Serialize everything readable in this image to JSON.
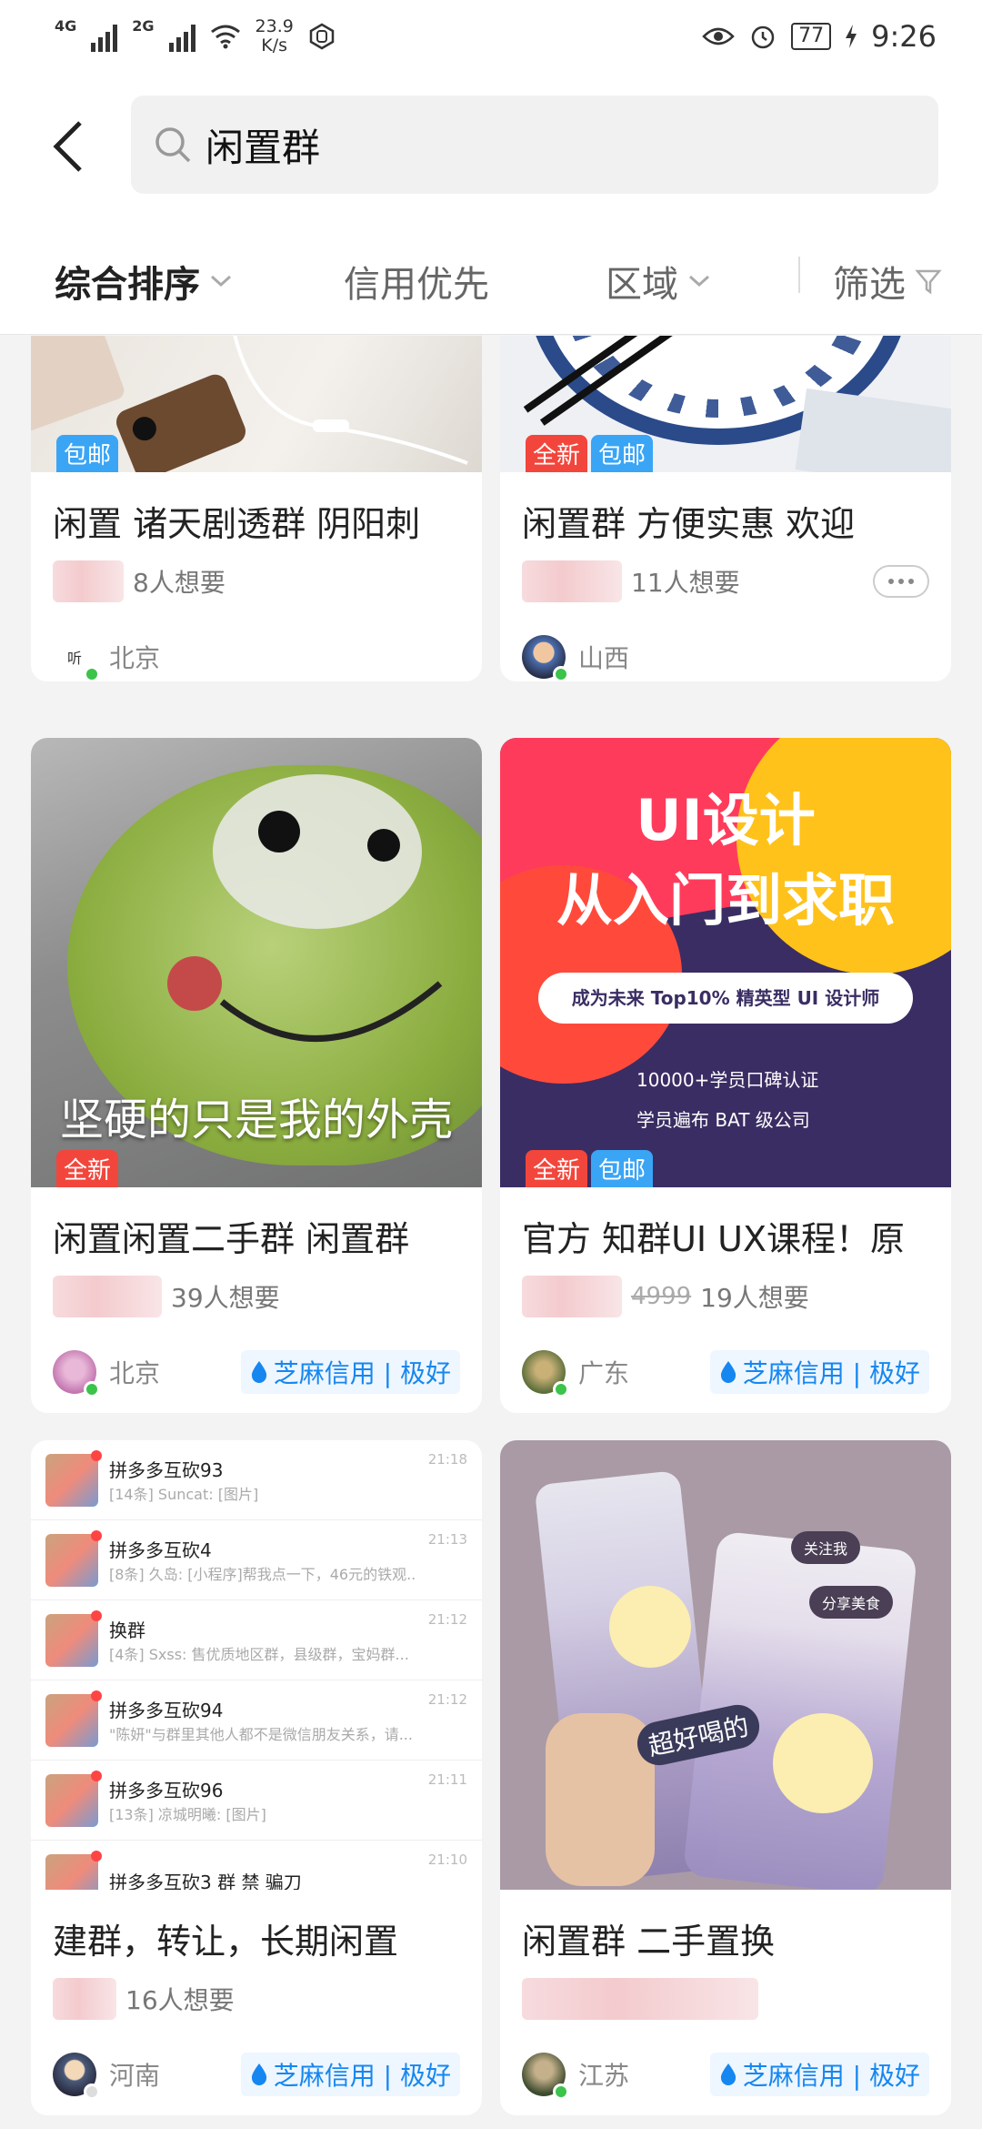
{
  "status": {
    "net1": "4G",
    "net2": "2G",
    "speed_value": "23.9",
    "speed_unit": "K/s",
    "battery": "77",
    "time": "9:26"
  },
  "search": {
    "query": "闲置群"
  },
  "filters": {
    "sort": "综合排序",
    "credit_first": "信用优先",
    "region": "区域",
    "filter": "筛选"
  },
  "tags": {
    "new": "全新",
    "package": "包邮"
  },
  "credit_label": "芝麻信用 | 极好",
  "cards": [
    {
      "title": "闲置 诸天剧透群 阴阳刺",
      "want": "8人想要",
      "location": "北京",
      "avatar_text": "听"
    },
    {
      "title": "闲置群   方便实惠  欢迎",
      "want": "11人想要",
      "location": "山西"
    },
    {
      "title": "闲置闲置二手群 闲置群",
      "want": "39人想要",
      "location": "北京",
      "image_caption": "坚硬的只是我的外壳"
    },
    {
      "title": "官方 知群UI UX课程！原",
      "price_fragment": "4999",
      "want": "19人想要",
      "location": "广东",
      "promo": {
        "line1": "UI设计",
        "line2": "从入门到求职",
        "pill": "成为未来 Top10% 精英型 UI 设计师",
        "bullet1": "10000+学员口碑认证",
        "bullet2": "学员遍布 BAT 级公司"
      }
    },
    {
      "title": "建群，转让，长期闲置",
      "want": "16人想要",
      "location": "河南",
      "chats": [
        {
          "name": "拼多多互砍93",
          "msg": "[14条] Suncat: [图片]",
          "time": "21:18"
        },
        {
          "name": "拼多多互砍4",
          "msg": "[8条] 久岛: [小程序]帮我点一下，46元的铁观...",
          "time": "21:13"
        },
        {
          "name": "换群",
          "msg": "[4条] Sxss: 售优质地区群，县级群，宝妈群...",
          "time": "21:12"
        },
        {
          "name": "拼多多互砍94",
          "msg": "\"陈妍\"与群里其他人都不是微信朋友关系，请...",
          "time": "21:12"
        },
        {
          "name": "拼多多互砍96",
          "msg": "[13条] 凉城明曦: [图片]",
          "time": "21:11"
        },
        {
          "name": "拼多多互砍3 群 禁 骗刀",
          "msg": "",
          "time": "21:10"
        }
      ]
    },
    {
      "title": "闲置群 二手置换",
      "want": "",
      "location": "江苏",
      "photo_labels": {
        "follow": "关注我",
        "share": "分享美食",
        "drink": "超好喝的"
      }
    }
  ]
}
